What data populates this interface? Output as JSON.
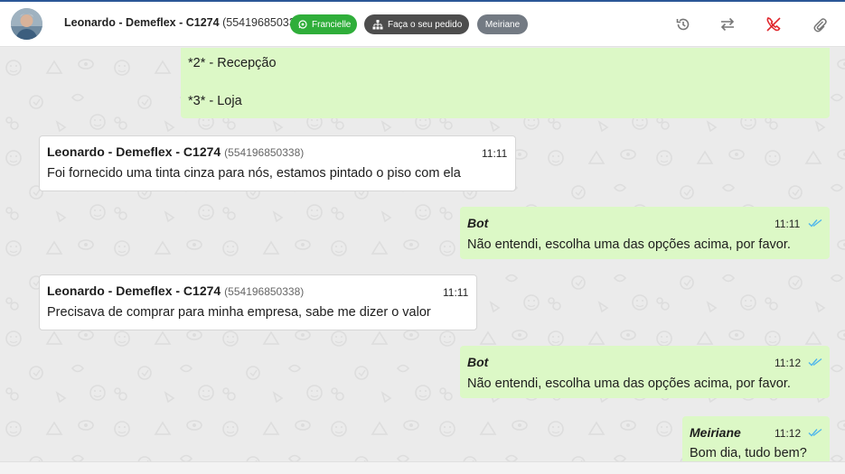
{
  "header": {
    "contact_name": "Leonardo - Demeflex - C1274",
    "contact_phone": "(554196850338)",
    "tags": [
      {
        "label": "Francielle",
        "icon": "whatsapp-icon",
        "color": "#2fae3a"
      },
      {
        "label": "Faça o seu pedido",
        "icon": "sitemap-icon",
        "color": "#4d4d4d"
      },
      {
        "label": "Meiriane",
        "color": "#737a83"
      }
    ],
    "actions": [
      "history-icon",
      "transfer-icon",
      "hangup-icon",
      "attachment-icon"
    ]
  },
  "messages": [
    {
      "direction": "out",
      "lines": [
        "*2* - Recepção",
        "*3* - Loja"
      ]
    },
    {
      "direction": "in",
      "sender": "Leonardo - Demeflex - C1274",
      "phone": "(554196850338)",
      "time": "11:11",
      "text": "Foi fornecido uma tinta cinza para nós, estamos pintado o piso com ela"
    },
    {
      "direction": "out",
      "sender": "Bot",
      "time": "11:11",
      "text": "Não entendi, escolha uma das opções acima, por favor."
    },
    {
      "direction": "in",
      "sender": "Leonardo - Demeflex - C1274",
      "phone": "(554196850338)",
      "time": "11:11",
      "text": "Precisava de comprar para minha empresa, sabe me dizer o valor"
    },
    {
      "direction": "out",
      "sender": "Bot",
      "time": "11:12",
      "text": "Não entendi, escolha uma das opções acima, por favor."
    },
    {
      "direction": "out",
      "sender": "Meiriane",
      "time": "11:12",
      "text": "Bom dia, tudo bem?"
    }
  ],
  "colors": {
    "incoming": "#ffffff",
    "outgoing": "#dcf8c6",
    "read_ticks": "#4fb6ec",
    "hangup": "#e0282e"
  }
}
